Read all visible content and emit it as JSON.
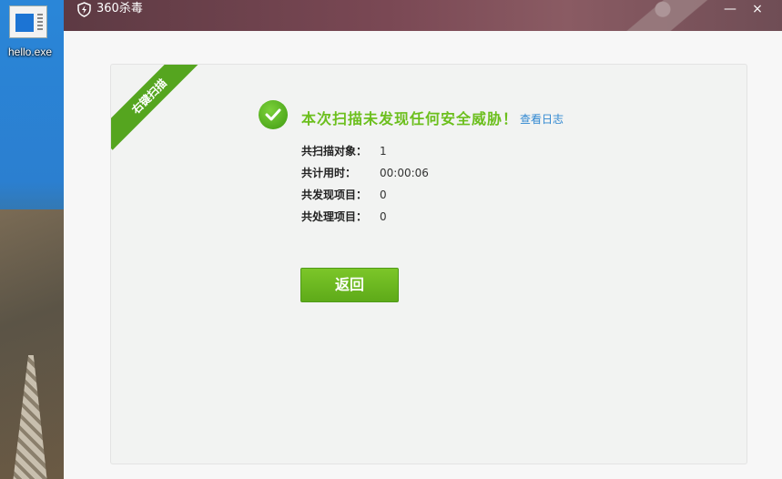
{
  "desktop": {
    "icon_label": "hello.exe"
  },
  "window": {
    "title": "360杀毒",
    "minimize_glyph": "—",
    "close_glyph": "×"
  },
  "ribbon": {
    "label": "右键扫描"
  },
  "result": {
    "headline": "本次扫描未发现任何安全威胁！",
    "view_log": "查看日志"
  },
  "stats": [
    {
      "label": "共扫描对象：",
      "value": "1"
    },
    {
      "label": "共计用时：",
      "value": "00:00:06"
    },
    {
      "label": "共发现项目：",
      "value": "0"
    },
    {
      "label": "共处理项目：",
      "value": "0"
    }
  ],
  "actions": {
    "back_label": "返回"
  },
  "colors": {
    "accent_green": "#6cbf1d",
    "link_blue": "#3188d1",
    "titlebar": "#6f4552"
  },
  "icons": [
    "app-logo-icon",
    "check-icon",
    "exe-file-icon",
    "minimize-icon",
    "close-icon"
  ]
}
